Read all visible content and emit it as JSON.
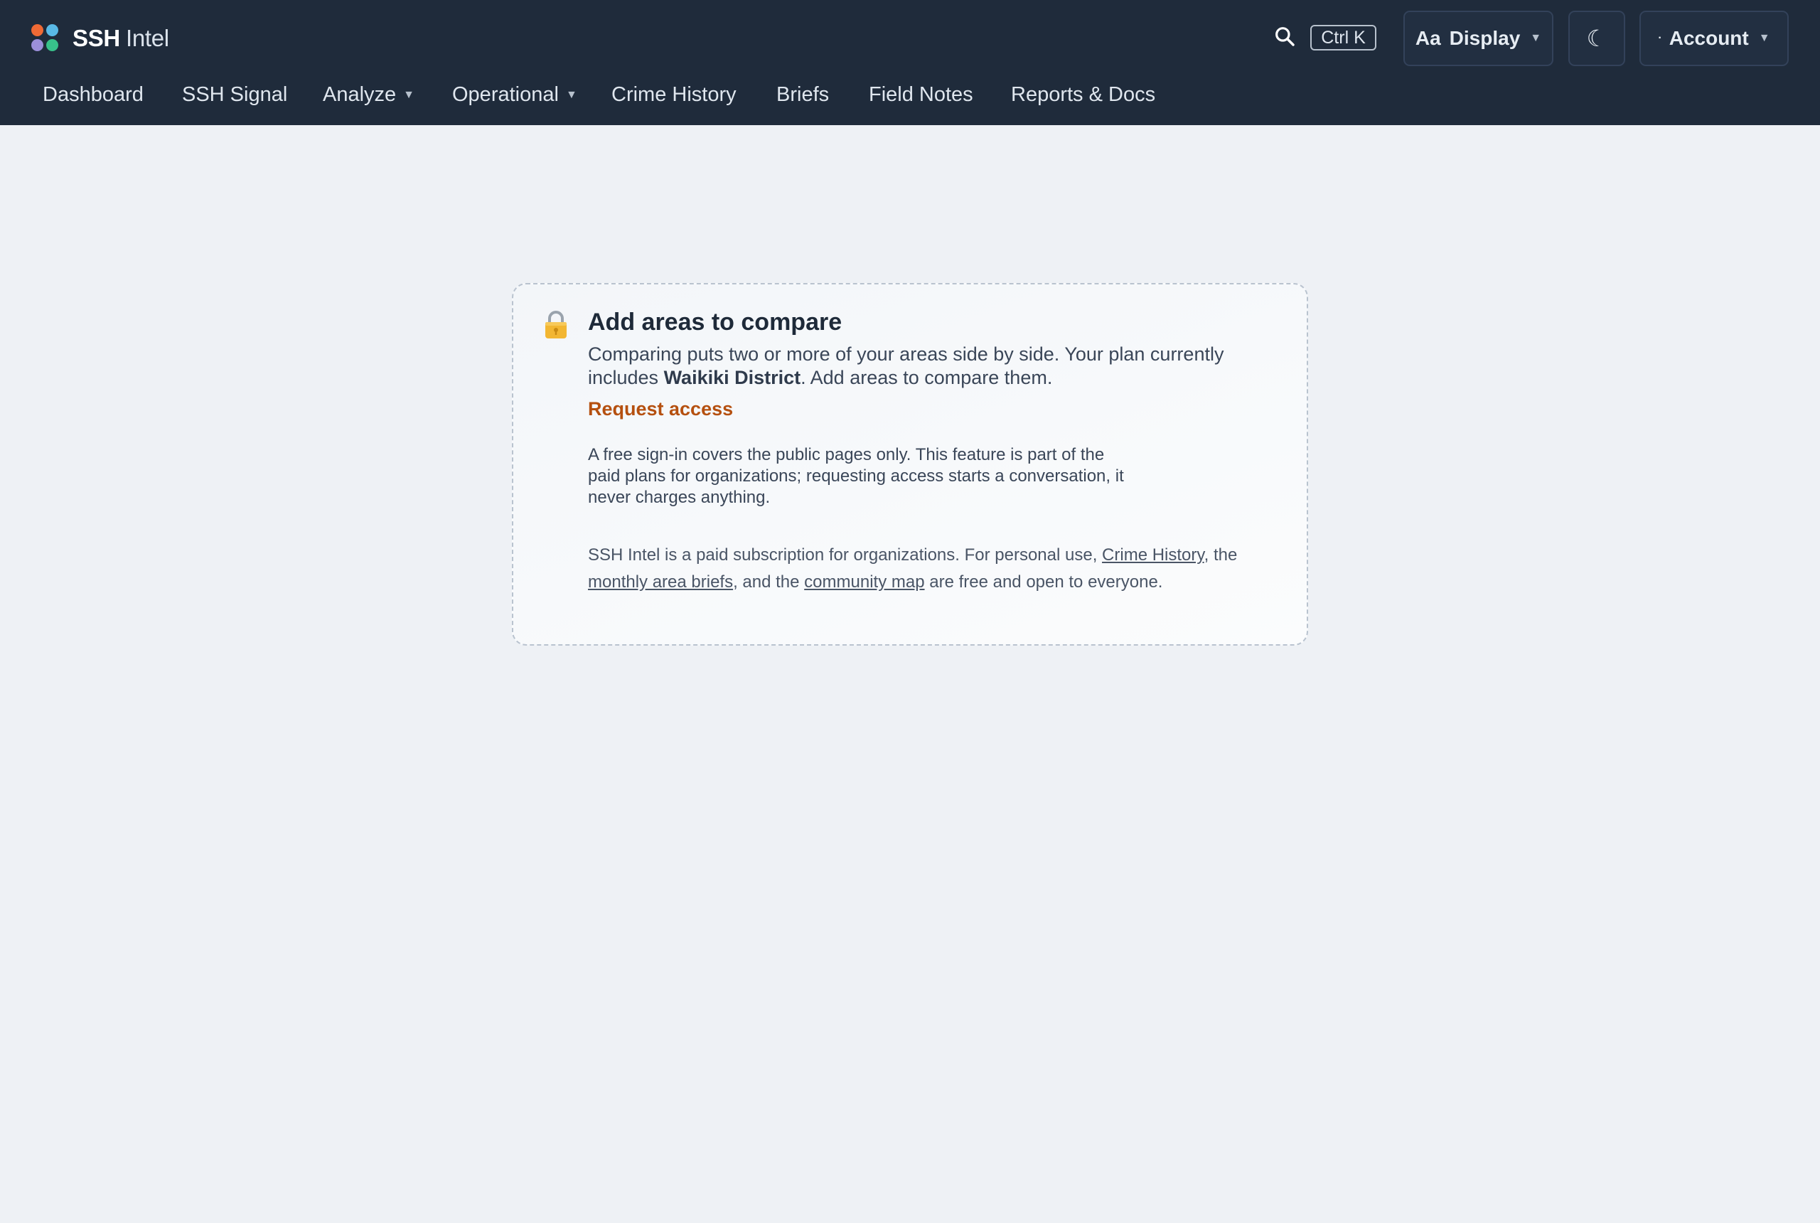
{
  "brand": {
    "bold": "SSH",
    "light": "Intel"
  },
  "header": {
    "search_shortcut": "Ctrl K",
    "display_label": "Display",
    "display_icon_text": "Aa",
    "account_label": "Account"
  },
  "nav": [
    {
      "label": "Dashboard"
    },
    {
      "label": "SSH Signal"
    },
    {
      "label": "Analyze"
    },
    {
      "label": "Operational"
    },
    {
      "label": "Crime History"
    },
    {
      "label": "Briefs"
    },
    {
      "label": "Field Notes"
    },
    {
      "label": "Reports & Docs"
    }
  ],
  "card": {
    "title": "Add areas to compare",
    "desc_before": "Comparing puts two or more of your areas side by side. Your plan currently includes ",
    "desc_area": "Waikiki District",
    "desc_after": ". Add areas to compare them.",
    "request_label": "Request access",
    "note": "A free sign-in covers the public pages only. This feature is part of the paid plans for organizations; requesting access starts a conversation, it never charges anything.",
    "footer_before": "SSH Intel is a paid subscription for organizations. For personal use, ",
    "footer_link1": "Crime History",
    "footer_mid1": ", the ",
    "footer_link2": "monthly area briefs",
    "footer_mid2": ", and the ",
    "footer_link3": "community map",
    "footer_after": " are free and open to everyone."
  },
  "colors": {
    "header_bg": "#1f2b3b",
    "page_bg": "#eef1f5",
    "accent": "#b5500f"
  },
  "icons": {
    "logo": "four-dot-logo-icon",
    "search": "search-icon",
    "theme": "moon-icon",
    "lock": "lock-icon",
    "caret": "chevron-down-icon"
  }
}
